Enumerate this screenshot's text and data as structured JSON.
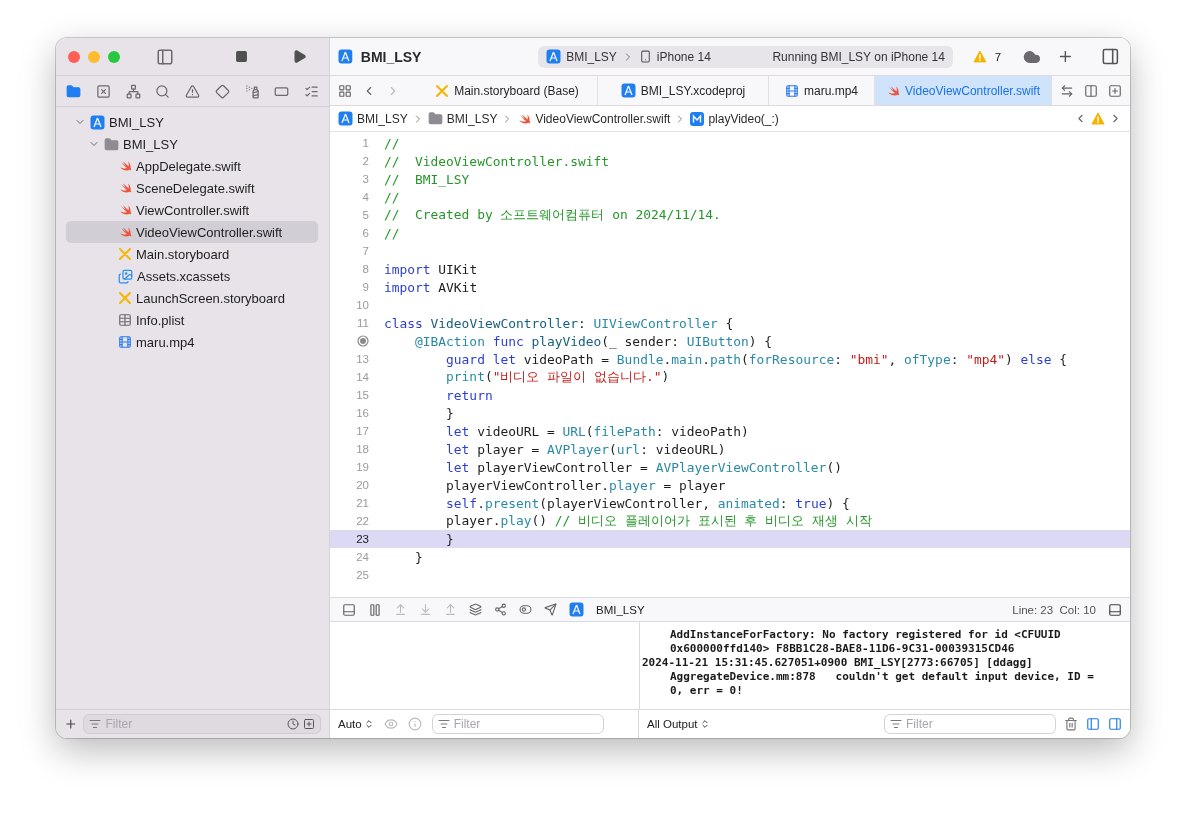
{
  "window": {
    "title": "BMI_LSY"
  },
  "toolbar": {
    "scheme": "BMI_LSY",
    "device": "iPhone 14",
    "status": "Running BMI_LSY on iPhone 14",
    "warnings": "7"
  },
  "navigator_tabs": [
    {
      "kind": "project",
      "selected": true
    },
    {
      "kind": "source-control",
      "selected": false
    },
    {
      "kind": "hierarchy",
      "selected": false
    },
    {
      "kind": "search",
      "selected": false
    },
    {
      "kind": "issue",
      "selected": false
    },
    {
      "kind": "test",
      "selected": false
    },
    {
      "kind": "debug",
      "selected": false
    },
    {
      "kind": "breakpoint",
      "selected": false
    },
    {
      "kind": "report",
      "selected": false
    }
  ],
  "tree": [
    {
      "label": "BMI_LSY",
      "kind": "project",
      "expanded": true,
      "selected": false,
      "children": [
        {
          "label": "BMI_LSY",
          "kind": "folder",
          "expanded": true,
          "selected": false,
          "children": [
            {
              "label": "AppDelegate.swift",
              "kind": "swift",
              "selected": false
            },
            {
              "label": "SceneDelegate.swift",
              "kind": "swift",
              "selected": false
            },
            {
              "label": "ViewController.swift",
              "kind": "swift",
              "selected": false
            },
            {
              "label": "VideoViewController.swift",
              "kind": "swift",
              "selected": true
            },
            {
              "label": "Main.storyboard",
              "kind": "storyboard",
              "selected": false
            },
            {
              "label": "Assets.xcassets",
              "kind": "assets",
              "selected": false
            },
            {
              "label": "LaunchScreen.storyboard",
              "kind": "storyboard",
              "selected": false
            },
            {
              "label": "Info.plist",
              "kind": "plist",
              "selected": false
            },
            {
              "label": "maru.mp4",
              "kind": "video",
              "selected": false
            }
          ]
        }
      ]
    }
  ],
  "navigator_filter": {
    "placeholder": "Filter"
  },
  "tabs": [
    {
      "label": "Main.storyboard (Base)",
      "kind": "storyboard",
      "selected": false
    },
    {
      "label": "BMI_LSY.xcodeproj",
      "kind": "project",
      "selected": false
    },
    {
      "label": "maru.mp4",
      "kind": "video",
      "selected": false
    },
    {
      "label": "VideoViewController.swift",
      "kind": "swift",
      "selected": true
    }
  ],
  "jump_bar": [
    {
      "label": "BMI_LSY",
      "kind": "project"
    },
    {
      "label": "BMI_LSY",
      "kind": "folder"
    },
    {
      "label": "VideoViewController.swift",
      "kind": "swift"
    },
    {
      "label": "playVideo(_:)",
      "kind": "method"
    }
  ],
  "code": {
    "lines": [
      {
        "kind": "numbered",
        "number": "1",
        "current": false,
        "tokens": [
          {
            "kind": "comment",
            "text": "//"
          }
        ]
      },
      {
        "kind": "numbered",
        "number": "2",
        "current": false,
        "tokens": [
          {
            "kind": "comment",
            "text": "//  VideoViewController.swift"
          }
        ]
      },
      {
        "kind": "numbered",
        "number": "3",
        "current": false,
        "tokens": [
          {
            "kind": "comment",
            "text": "//  BMI_LSY"
          }
        ]
      },
      {
        "kind": "numbered",
        "number": "4",
        "current": false,
        "tokens": [
          {
            "kind": "comment",
            "text": "//"
          }
        ]
      },
      {
        "kind": "numbered",
        "number": "5",
        "current": false,
        "tokens": [
          {
            "kind": "comment",
            "text": "//  Created by 소프트웨어컴퓨터 on 2024/11/14."
          }
        ]
      },
      {
        "kind": "numbered",
        "number": "6",
        "current": false,
        "tokens": [
          {
            "kind": "comment",
            "text": "//"
          }
        ]
      },
      {
        "kind": "numbered",
        "number": "7",
        "current": false
      },
      {
        "kind": "numbered",
        "number": "8",
        "current": false,
        "tokens": [
          {
            "kind": "keyword",
            "text": "import"
          },
          {
            "kind": "plain",
            "text": " UIKit"
          }
        ]
      },
      {
        "kind": "numbered",
        "number": "9",
        "current": false,
        "tokens": [
          {
            "kind": "keyword",
            "text": "import"
          },
          {
            "kind": "plain",
            "text": " AVKit"
          }
        ]
      },
      {
        "kind": "numbered",
        "number": "10",
        "current": false
      },
      {
        "kind": "numbered",
        "number": "11",
        "current": false,
        "tokens": [
          {
            "kind": "keyword",
            "text": "class"
          },
          {
            "kind": "declaration",
            "text": " VideoViewController"
          },
          {
            "kind": "plain",
            "text": ": "
          },
          {
            "kind": "type",
            "text": "UIViewController"
          },
          {
            "kind": "plain",
            "text": " {"
          }
        ]
      },
      {
        "kind": "outlet",
        "current": false,
        "tokens": [
          {
            "kind": "type",
            "text": "    @IBAction"
          },
          {
            "kind": "keyword",
            "text": " func"
          },
          {
            "kind": "declaration",
            "text": " playVideo"
          },
          {
            "kind": "plain",
            "text": "(_ sender: "
          },
          {
            "kind": "type",
            "text": "UIButton"
          },
          {
            "kind": "plain",
            "text": ") {"
          }
        ]
      },
      {
        "kind": "numbered",
        "number": "13",
        "current": false,
        "tokens": [
          {
            "kind": "keyword",
            "text": "        guard"
          },
          {
            "kind": "keyword",
            "text": " let"
          },
          {
            "kind": "plain",
            "text": " videoPath = "
          },
          {
            "kind": "type",
            "text": "Bundle"
          },
          {
            "kind": "plain",
            "text": "."
          },
          {
            "kind": "type",
            "text": "main"
          },
          {
            "kind": "plain",
            "text": "."
          },
          {
            "kind": "type",
            "text": "path"
          },
          {
            "kind": "plain",
            "text": "("
          },
          {
            "kind": "type",
            "text": "forResource"
          },
          {
            "kind": "plain",
            "text": ": "
          },
          {
            "kind": "string",
            "text": "\"bmi\""
          },
          {
            "kind": "plain",
            "text": ", "
          },
          {
            "kind": "type",
            "text": "ofType"
          },
          {
            "kind": "plain",
            "text": ": "
          },
          {
            "kind": "string",
            "text": "\"mp4\""
          },
          {
            "kind": "plain",
            "text": ") "
          },
          {
            "kind": "keyword",
            "text": "else"
          },
          {
            "kind": "plain",
            "text": " {"
          }
        ]
      },
      {
        "kind": "numbered",
        "number": "14",
        "current": false,
        "tokens": [
          {
            "kind": "type",
            "text": "        print"
          },
          {
            "kind": "plain",
            "text": "("
          },
          {
            "kind": "string",
            "text": "\"비디오 파일이 없습니다.\""
          },
          {
            "kind": "plain",
            "text": ")"
          }
        ]
      },
      {
        "kind": "numbered",
        "number": "15",
        "current": false,
        "tokens": [
          {
            "kind": "keyword",
            "text": "        return"
          }
        ]
      },
      {
        "kind": "numbered",
        "number": "16",
        "current": false,
        "tokens": [
          {
            "kind": "plain",
            "text": "        }"
          }
        ]
      },
      {
        "kind": "numbered",
        "number": "17",
        "current": false,
        "tokens": [
          {
            "kind": "keyword",
            "text": "        let"
          },
          {
            "kind": "plain",
            "text": " videoURL = "
          },
          {
            "kind": "type",
            "text": "URL"
          },
          {
            "kind": "plain",
            "text": "("
          },
          {
            "kind": "type",
            "text": "filePath"
          },
          {
            "kind": "plain",
            "text": ": videoPath)"
          }
        ]
      },
      {
        "kind": "numbered",
        "number": "18",
        "current": false,
        "tokens": [
          {
            "kind": "keyword",
            "text": "        let"
          },
          {
            "kind": "plain",
            "text": " player = "
          },
          {
            "kind": "type",
            "text": "AVPlayer"
          },
          {
            "kind": "plain",
            "text": "("
          },
          {
            "kind": "type",
            "text": "url"
          },
          {
            "kind": "plain",
            "text": ": videoURL)"
          }
        ]
      },
      {
        "kind": "numbered",
        "number": "19",
        "current": false,
        "tokens": [
          {
            "kind": "keyword",
            "text": "        let"
          },
          {
            "kind": "plain",
            "text": " playerViewController = "
          },
          {
            "kind": "type",
            "text": "AVPlayerViewController"
          },
          {
            "kind": "plain",
            "text": "()"
          }
        ]
      },
      {
        "kind": "numbered",
        "number": "20",
        "current": false,
        "tokens": [
          {
            "kind": "plain",
            "text": "        playerViewController."
          },
          {
            "kind": "type",
            "text": "player"
          },
          {
            "kind": "plain",
            "text": " = player"
          }
        ]
      },
      {
        "kind": "numbered",
        "number": "21",
        "current": false,
        "tokens": [
          {
            "kind": "keyword",
            "text": "        self"
          },
          {
            "kind": "plain",
            "text": "."
          },
          {
            "kind": "type",
            "text": "present"
          },
          {
            "kind": "plain",
            "text": "(playerViewController, "
          },
          {
            "kind": "type",
            "text": "animated"
          },
          {
            "kind": "plain",
            "text": ": "
          },
          {
            "kind": "keyword",
            "text": "true"
          },
          {
            "kind": "plain",
            "text": ") {"
          }
        ]
      },
      {
        "kind": "numbered",
        "number": "22",
        "current": false,
        "tokens": [
          {
            "kind": "plain",
            "text": "        player."
          },
          {
            "kind": "type",
            "text": "play"
          },
          {
            "kind": "plain",
            "text": "() "
          },
          {
            "kind": "comment",
            "text": "// 비디오 플레이어가 표시된 후 비디오 재생 시작"
          }
        ]
      },
      {
        "kind": "numbered",
        "number": "23",
        "current": true,
        "tokens": [
          {
            "kind": "plain",
            "text": "        }"
          }
        ]
      },
      {
        "kind": "numbered",
        "number": "24",
        "current": false,
        "tokens": [
          {
            "kind": "plain",
            "text": "    }"
          }
        ]
      },
      {
        "kind": "numbered",
        "number": "25",
        "current": false
      }
    ]
  },
  "debug_bar": {
    "target": "BMI_LSY",
    "position": "Line: 23  Col: 10"
  },
  "variables": {
    "scope": "Auto",
    "filter": {
      "placeholder": "Filter"
    }
  },
  "console": {
    "lines": [
      {
        "text": "AddInstanceForFactory: No factory registered for id <CFUUID",
        "continuation": true
      },
      {
        "text": "0x600000ffd140> F8BB1C28-BAE8-11D6-9C31-00039315CD46",
        "continuation": true
      },
      {
        "text": "2024-11-21 15:31:45.627051+0900 BMI_LSY[2773:66705] [ddagg]",
        "continuation": false
      },
      {
        "text": "AggregateDevice.mm:878   couldn't get default input device, ID =",
        "continuation": true
      },
      {
        "text": "0, err = 0!",
        "continuation": true
      }
    ],
    "output": "All Output",
    "filter": {
      "placeholder": "Filter"
    }
  }
}
